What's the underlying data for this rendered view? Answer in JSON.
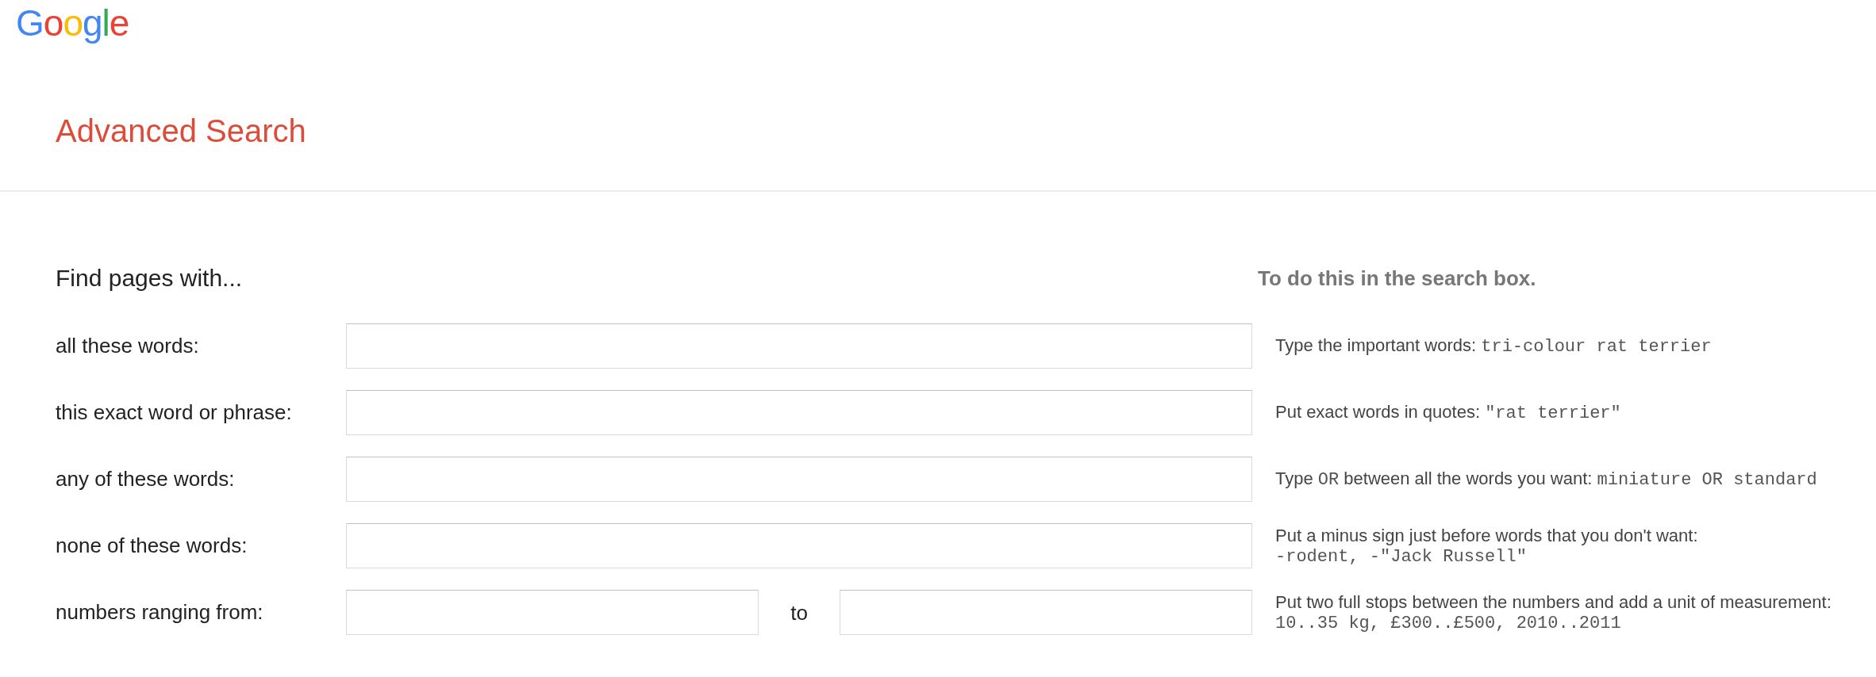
{
  "logo": {
    "text": "Google"
  },
  "title": "Advanced Search",
  "section": {
    "heading": "Find pages with...",
    "hint_heading": "To do this in the search box."
  },
  "fields": [
    {
      "label": "all these words:",
      "kind": "single",
      "hint": [
        {
          "kind": "text",
          "text": "Type the important words: "
        },
        {
          "kind": "code",
          "text": "tri-colour rat terrier"
        }
      ]
    },
    {
      "label": "this exact word or phrase:",
      "kind": "single",
      "hint": [
        {
          "kind": "text",
          "text": "Put exact words in quotes: "
        },
        {
          "kind": "code",
          "text": "\"rat terrier\""
        }
      ]
    },
    {
      "label": "any of these words:",
      "kind": "single",
      "hint": [
        {
          "kind": "text",
          "text": "Type "
        },
        {
          "kind": "code",
          "text": "OR"
        },
        {
          "kind": "text",
          "text": " between all the words you want: "
        },
        {
          "kind": "code",
          "text": "miniature OR standard"
        }
      ]
    },
    {
      "label": "none of these words:",
      "kind": "single",
      "hint": [
        {
          "kind": "text",
          "text": "Put a minus sign just before words that you don't want: "
        },
        {
          "kind": "code",
          "text": "-rodent, -\"Jack Russell\""
        }
      ]
    },
    {
      "label": "numbers ranging from:",
      "kind": "range",
      "separator": "to",
      "hint": [
        {
          "kind": "text",
          "text": "Put two full stops between the numbers and add a unit of measurement: "
        },
        {
          "kind": "code",
          "text": "10..35 kg, £300..£500, 2010..2011"
        }
      ]
    }
  ]
}
